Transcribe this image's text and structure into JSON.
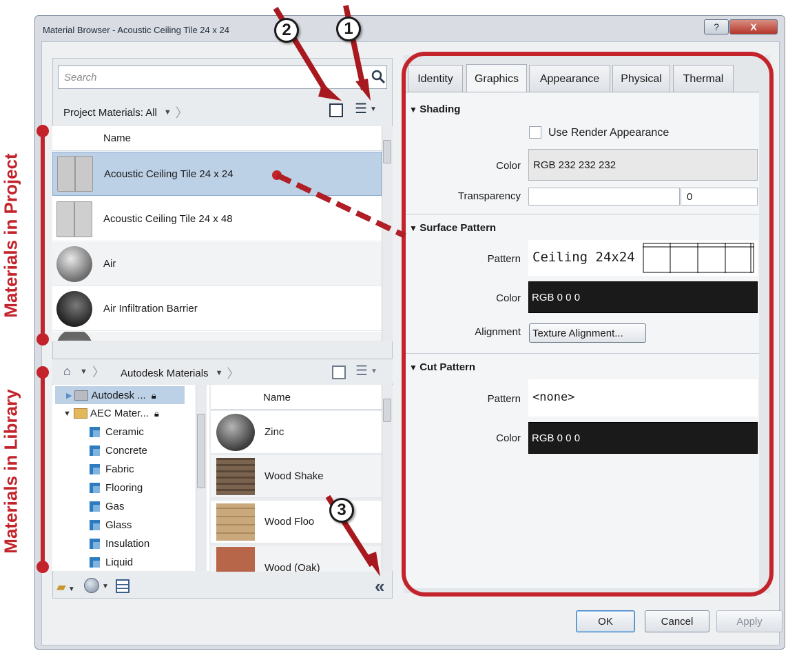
{
  "window": {
    "title": "Material Browser - Acoustic Ceiling Tile 24 x 24",
    "help_glyph": "?",
    "close_glyph": "X"
  },
  "search": {
    "placeholder": "Search"
  },
  "project": {
    "filter_label": "Project Materials: All",
    "column_header": "Name",
    "materials": [
      "Acoustic Ceiling Tile 24 x 24",
      "Acoustic Ceiling Tile 24 x 48",
      "Air",
      "Air Infiltration Barrier"
    ]
  },
  "library": {
    "breadcrumb": "Autodesk Materials",
    "column_header": "Name",
    "tree": [
      {
        "label": "Autodesk ...",
        "type": "library",
        "locked": true
      },
      {
        "label": "AEC Mater...",
        "type": "library",
        "locked": true
      },
      {
        "label": "Ceramic",
        "type": "category"
      },
      {
        "label": "Concrete",
        "type": "category"
      },
      {
        "label": "Fabric",
        "type": "category"
      },
      {
        "label": "Flooring",
        "type": "category"
      },
      {
        "label": "Gas",
        "type": "category"
      },
      {
        "label": "Glass",
        "type": "category"
      },
      {
        "label": "Insulation",
        "type": "category"
      },
      {
        "label": "Liquid",
        "type": "category"
      }
    ],
    "materials": [
      "Zinc",
      "Wood Shake",
      "Wood Floo",
      "Wood (Oak)"
    ],
    "collapse_glyph": "«"
  },
  "tabs": [
    "Identity",
    "Graphics",
    "Appearance",
    "Physical",
    "Thermal"
  ],
  "active_tab": "Graphics",
  "shading": {
    "title": "Shading",
    "use_render_label": "Use Render Appearance",
    "color_label": "Color",
    "color_value": "RGB 232 232 232",
    "transparency_label": "Transparency",
    "transparency_value": "0"
  },
  "surface_pattern": {
    "title": "Surface Pattern",
    "pattern_label": "Pattern",
    "pattern_value": "Ceiling 24x24",
    "color_label": "Color",
    "color_value": "RGB 0 0 0",
    "alignment_label": "Alignment",
    "alignment_button": "Texture Alignment..."
  },
  "cut_pattern": {
    "title": "Cut Pattern",
    "pattern_label": "Pattern",
    "pattern_value": "<none>",
    "color_label": "Color",
    "color_value": "RGB 0 0 0"
  },
  "buttons": {
    "ok": "OK",
    "cancel": "Cancel",
    "apply": "Apply"
  },
  "annotations": {
    "callouts": [
      "1",
      "2",
      "3"
    ],
    "side_labels": [
      "Materials in Project",
      "Materials in Library"
    ],
    "accent_color": "#c3242c"
  }
}
